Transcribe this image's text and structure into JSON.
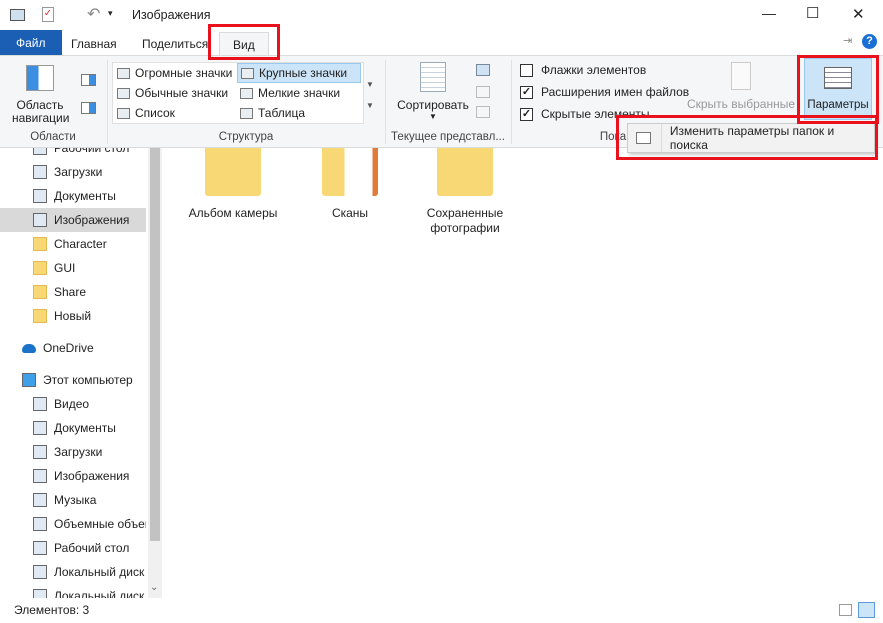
{
  "window": {
    "title": "Изображения",
    "minimize": "—",
    "maximize": "☐",
    "close": "✕"
  },
  "tabs": [
    {
      "label": "Файл"
    },
    {
      "label": "Главная"
    },
    {
      "label": "Поделиться"
    },
    {
      "label": "Вид"
    }
  ],
  "ribbon": {
    "areas": {
      "nav_pane": "Область навигации",
      "group": "Области"
    },
    "layout": {
      "items": [
        "Огромные значки",
        "Крупные значки",
        "Обычные значки",
        "Мелкие значки",
        "Список",
        "Таблица"
      ],
      "selected": "Крупные значки",
      "group": "Структура"
    },
    "current_view": {
      "sort": "Сортировать",
      "group": "Текущее представл..."
    },
    "show_hide": {
      "checkboxes": [
        {
          "label": "Флажки элементов",
          "checked": false
        },
        {
          "label": "Расширения имен файлов",
          "checked": true
        },
        {
          "label": "Скрытые элементы",
          "checked": true
        }
      ],
      "hide_selected": "Скрыть выбранные элементы",
      "group": "Пока"
    },
    "options": {
      "label": "Параметры"
    }
  },
  "dropdown": {
    "item": "Изменить параметры папок и поиска"
  },
  "sidebar": {
    "quick": [
      "Рабочий стол",
      "Загрузки",
      "Документы",
      "Изображения",
      "Character",
      "GUI",
      "Share",
      "Новый"
    ],
    "selected": "Изображения",
    "onedrive": "OneDrive",
    "this_pc": "Этот компьютер",
    "pc_items": [
      "Видео",
      "Документы",
      "Загрузки",
      "Изображения",
      "Музыка",
      "Объемные объекты",
      "Рабочий стол",
      "Локальный диск",
      "Локальный диск"
    ]
  },
  "content": {
    "folders": [
      "Альбом камеры",
      "Сканы",
      "Сохраненные фотографии"
    ]
  },
  "status": {
    "count": "Элементов: 3"
  },
  "colors": {
    "accent": "#1a5fb4",
    "highlight": "#e8111c",
    "folder": "#f8d775"
  }
}
